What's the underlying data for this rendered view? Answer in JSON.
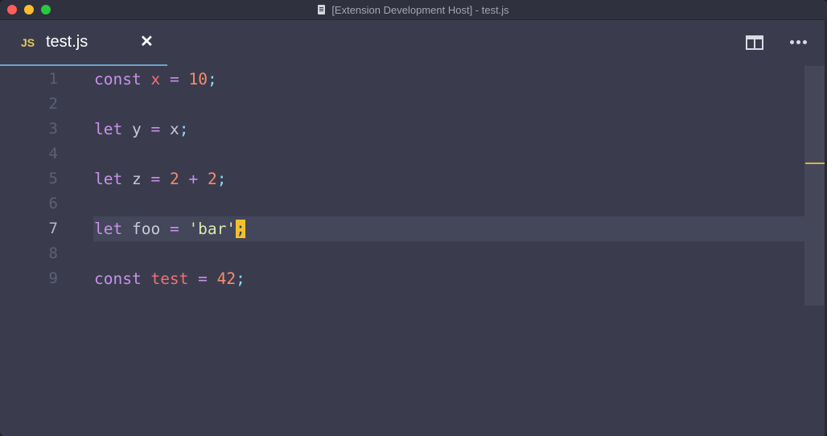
{
  "window": {
    "title": "[Extension Development Host] - test.js"
  },
  "tab": {
    "lang": "JS",
    "name": "test.js",
    "close": "✕"
  },
  "colors": {
    "keyword": "#c792ea",
    "variable": "#f07178",
    "number": "#f78c6c",
    "string": "#dde8a8",
    "punctuation": "#89ddff",
    "cursor": "#f2c12e"
  },
  "editor": {
    "current_line": 7,
    "lines": [
      {
        "n": "1",
        "tokens": [
          [
            "kw",
            "const"
          ],
          [
            "plain",
            " "
          ],
          [
            "var",
            "x"
          ],
          [
            "plain",
            " "
          ],
          [
            "op",
            "="
          ],
          [
            "plain",
            " "
          ],
          [
            "num",
            "10"
          ],
          [
            "punc",
            ";"
          ]
        ]
      },
      {
        "n": "2",
        "tokens": []
      },
      {
        "n": "3",
        "tokens": [
          [
            "kw",
            "let"
          ],
          [
            "plain",
            " y "
          ],
          [
            "op",
            "="
          ],
          [
            "plain",
            " x"
          ],
          [
            "punc",
            ";"
          ]
        ]
      },
      {
        "n": "4",
        "tokens": []
      },
      {
        "n": "5",
        "tokens": [
          [
            "kw",
            "let"
          ],
          [
            "plain",
            " z "
          ],
          [
            "op",
            "="
          ],
          [
            "plain",
            " "
          ],
          [
            "num",
            "2"
          ],
          [
            "plain",
            " "
          ],
          [
            "op",
            "+"
          ],
          [
            "plain",
            " "
          ],
          [
            "num",
            "2"
          ],
          [
            "punc",
            ";"
          ]
        ]
      },
      {
        "n": "6",
        "tokens": []
      },
      {
        "n": "7",
        "tokens": [
          [
            "kw",
            "let"
          ],
          [
            "plain",
            " foo "
          ],
          [
            "op",
            "="
          ],
          [
            "plain",
            " "
          ],
          [
            "str",
            "'bar'"
          ],
          [
            "cursor",
            ";"
          ]
        ]
      },
      {
        "n": "8",
        "tokens": []
      },
      {
        "n": "9",
        "tokens": [
          [
            "kw",
            "const"
          ],
          [
            "plain",
            " "
          ],
          [
            "var",
            "test"
          ],
          [
            "plain",
            " "
          ],
          [
            "op",
            "="
          ],
          [
            "plain",
            " "
          ],
          [
            "num",
            "42"
          ],
          [
            "punc",
            ";"
          ]
        ]
      }
    ]
  },
  "icons": {
    "split": "split-editor-icon",
    "more": "more-actions-icon"
  }
}
